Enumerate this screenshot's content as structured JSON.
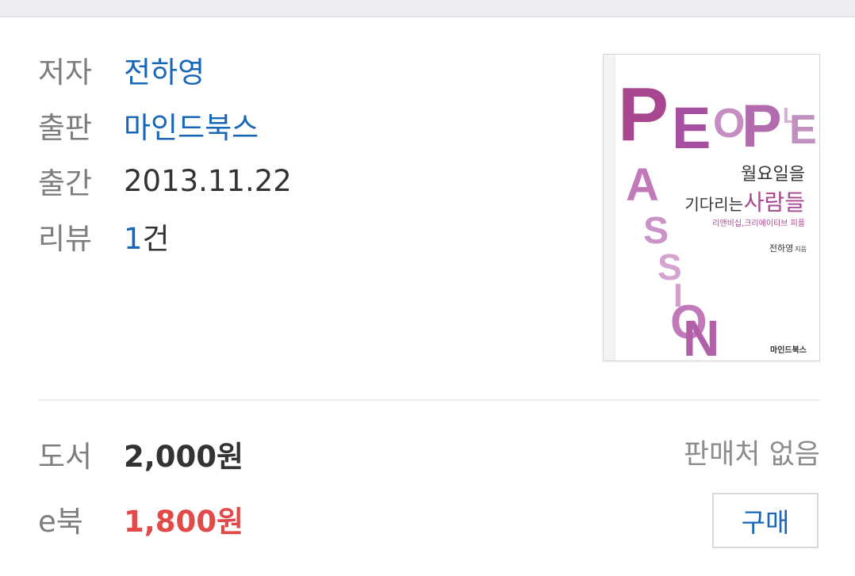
{
  "details": {
    "author_label": "저자",
    "author_value": "전하영",
    "publisher_label": "출판",
    "publisher_value": "마인드북스",
    "date_label": "출간",
    "date_value": "2013.11.22",
    "review_label": "리뷰",
    "review_count": "1",
    "review_unit": "건"
  },
  "cover": {
    "word_people": "PEOPLE",
    "word_passion": "PASSION",
    "title_line1": "월요일을",
    "title_line2_a": "기다리는",
    "title_line2_b": "사람들",
    "subtitle": "리앤비십,크리에이티브 피플",
    "author": "전하영",
    "author_suffix": "지음",
    "publisher": "마인드북스",
    "accent_color": "#a8478f"
  },
  "prices": {
    "book_label": "도서",
    "book_price": "2,000원",
    "no_seller": "판매처 없음",
    "ebook_label": "e북",
    "ebook_price": "1,800원",
    "buy_label": "구매"
  }
}
